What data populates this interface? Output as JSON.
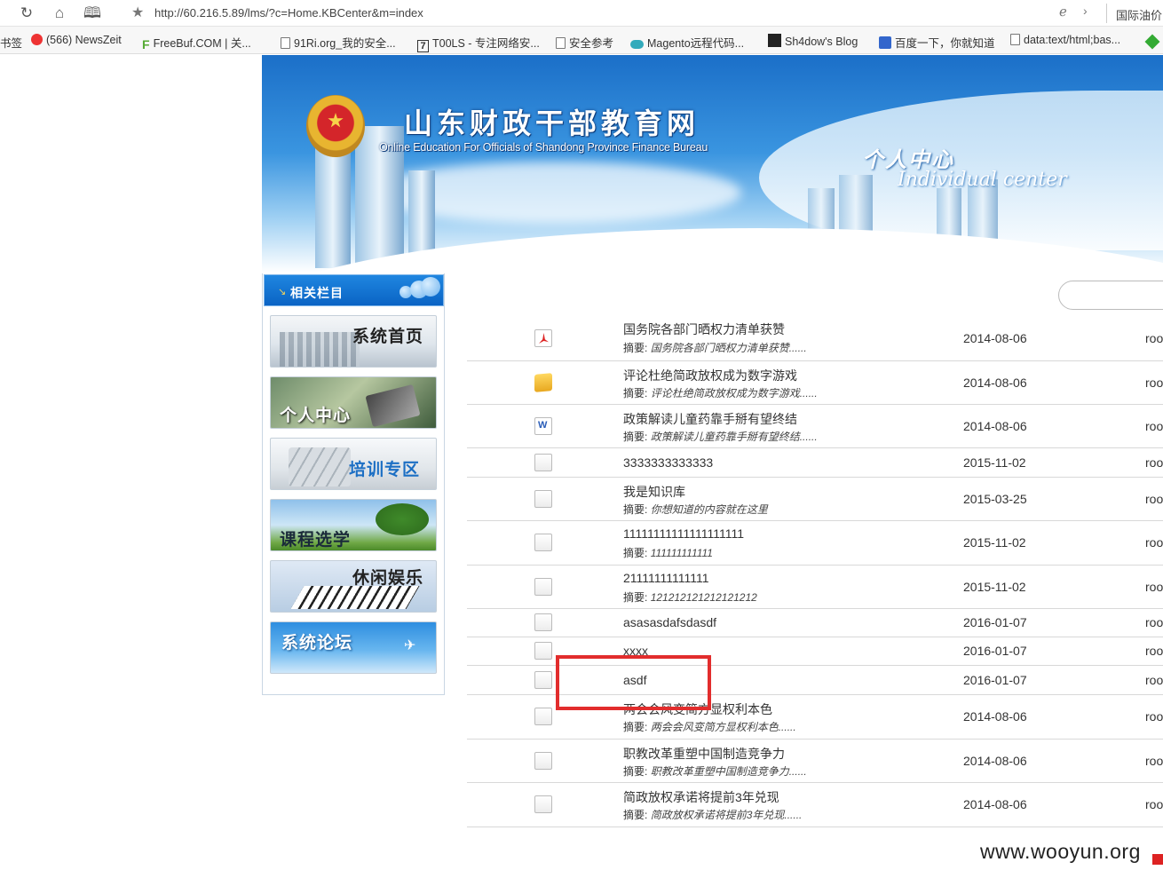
{
  "browser": {
    "url": "http://60.216.5.89/lms/?c=Home.KBCenter&m=index",
    "right_text": "国际油价",
    "bookmarks": [
      {
        "label": "书签",
        "icon": "none"
      },
      {
        "label": "(566) NewsZeit",
        "icon": "newszeit-icon"
      },
      {
        "label": "FreeBuf.COM | 关...",
        "icon": "freebuf-icon"
      },
      {
        "label": "91Ri.org_我的安全...",
        "icon": "page-icon"
      },
      {
        "label": "T00LS - 专注网络安...",
        "icon": "tools-icon"
      },
      {
        "label": "安全参考",
        "icon": "page-icon"
      },
      {
        "label": "Magento远程代码...",
        "icon": "cloud-icon"
      },
      {
        "label": "Sh4dow's Blog",
        "icon": "avatar-icon"
      },
      {
        "label": "百度一下，你就知道",
        "icon": "baidu-icon"
      },
      {
        "label": "data:text/html;bas...",
        "icon": "page-icon"
      }
    ]
  },
  "banner": {
    "site_title": "山东财政干部教育网",
    "site_subtitle": "Online Education For Officials of Shandong Province Finance Bureau",
    "section_cn": "个人中心",
    "section_en": "Individual center"
  },
  "sidebar": {
    "header": "相关栏目",
    "items": [
      {
        "label": "系统首页"
      },
      {
        "label": "个人中心"
      },
      {
        "label": "培训专区"
      },
      {
        "label": "课程选学"
      },
      {
        "label": "休闲娱乐"
      },
      {
        "label": "系统论坛"
      }
    ]
  },
  "list": {
    "summary_label": "摘要:",
    "rows": [
      {
        "title": "国务院各部门晒权力清单获赞",
        "summary": "国务院各部门晒权力清单获赞......",
        "date": "2014-08-06",
        "author": "roo",
        "icon": "pdf-icon"
      },
      {
        "title": "评论杜绝简政放权成为数字游戏",
        "summary": "评论杜绝简政放权成为数字游戏......",
        "date": "2014-08-06",
        "author": "roo",
        "icon": "package-icon"
      },
      {
        "title": "政策解读儿童药靠手掰有望终结",
        "summary": "政策解读儿童药靠手掰有望终结......",
        "date": "2014-08-06",
        "author": "roo",
        "icon": "word-doc-icon"
      },
      {
        "title": "3333333333333",
        "summary": "",
        "date": "2015-11-02",
        "author": "roo",
        "icon": "file-icon"
      },
      {
        "title": "我是知识库",
        "summary": "你想知道的内容就在这里",
        "date": "2015-03-25",
        "author": "roo",
        "icon": "file-icon"
      },
      {
        "title": "11111111111111111111",
        "summary": "111111111111",
        "date": "2015-11-02",
        "author": "roo",
        "icon": "file-icon"
      },
      {
        "title": "21111111111111",
        "summary": "121212121212121212",
        "date": "2015-11-02",
        "author": "roo",
        "icon": "file-icon"
      },
      {
        "title": "asasasdafsdasdf",
        "summary": "",
        "date": "2016-01-07",
        "author": "roo",
        "icon": "file-icon"
      },
      {
        "title": "xxxx",
        "summary": "",
        "date": "2016-01-07",
        "author": "roo",
        "icon": "file-icon"
      },
      {
        "title": "asdf",
        "summary": "",
        "date": "2016-01-07",
        "author": "roo",
        "icon": "file-icon"
      },
      {
        "title": "两会会风变简方显权利本色",
        "summary": "两会会风变简方显权利本色......",
        "date": "2014-08-06",
        "author": "roo",
        "icon": "file-icon"
      },
      {
        "title": "职教改革重塑中国制造竞争力",
        "summary": "职教改革重塑中国制造竞争力......",
        "date": "2014-08-06",
        "author": "roo",
        "icon": "file-icon"
      },
      {
        "title": "简政放权承诺将提前3年兑现",
        "summary": "简政放权承诺将提前3年兑现......",
        "date": "2014-08-06",
        "author": "roo",
        "icon": "file-icon"
      }
    ]
  },
  "watermark": "www.wooyun.org",
  "colors": {
    "highlight": "#e22d2d",
    "sidebar_header": "#0a63c4",
    "banner_blue": "#1b6fc8"
  }
}
